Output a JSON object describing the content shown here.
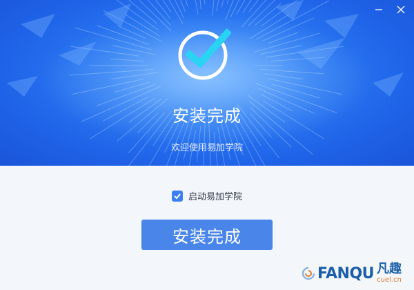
{
  "window": {
    "minimize_icon": "minimize-icon",
    "close_icon": "close-icon"
  },
  "hero": {
    "status_icon": "check-circle-icon",
    "title": "安装完成",
    "subtitle": "欢迎使用易加学院"
  },
  "options": {
    "launch_label": "启动易加学院",
    "launch_checked": true
  },
  "actions": {
    "finish_label": "安装完成"
  },
  "watermark": {
    "brand": "FANQU",
    "brand_cn": "凡趣",
    "domain": "cuel.cn"
  },
  "colors": {
    "hero_blue": "#1f63e8",
    "button_blue": "#4a86ea",
    "check_cyan": "#29d3f2",
    "background": "#f3f6fb"
  }
}
